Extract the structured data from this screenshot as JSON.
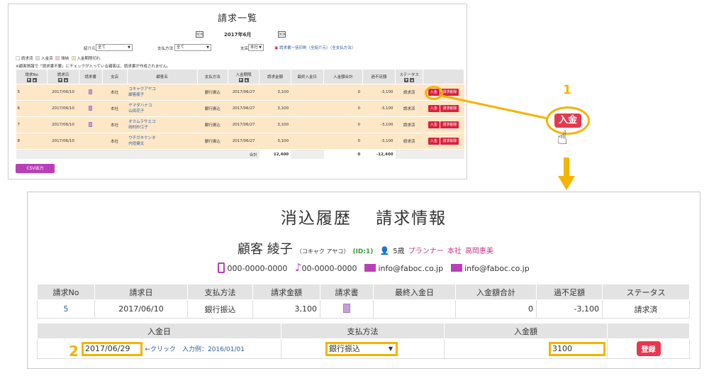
{
  "top": {
    "title": "請求一覧",
    "month": "2017年6月",
    "prev": "<<",
    "next": ">>",
    "filters": [
      {
        "label": "紹介元",
        "value": "全て"
      },
      {
        "label": "支払方法",
        "value": "全て"
      },
      {
        "label": "支店",
        "value": "本社"
      }
    ],
    "print_link": "請求書一括印刷（全紹介元）（全支払方法）",
    "legend": [
      "請求済",
      "入金済",
      "滞納",
      "入金期限切れ"
    ],
    "note": "※顧客情報で「請求書不要」にチェックが入っている顧客は、請求書が作成されません。",
    "columns": [
      "請求No",
      "請求日",
      "請求書",
      "支店",
      "顧客名",
      "支払方法",
      "入金期限",
      "請求金額",
      "最終入金日",
      "入金額合計",
      "過不足額",
      "ステータス",
      ""
    ],
    "rows": [
      {
        "no": "5",
        "date": "2017/06/10",
        "branch": "本社",
        "kana": "コキャクアヤコ",
        "name": "顧客綾子",
        "pay": "銀行振込",
        "due": "2017/06/27",
        "amount": "3,100",
        "total": "0",
        "diff": "-3,100",
        "status": "請求済",
        "has_doc": true
      },
      {
        "no": "6",
        "date": "2017/06/10",
        "branch": "本社",
        "kana": "ヤマダハナコ",
        "name": "山田花子",
        "pay": "銀行振込",
        "due": "2017/06/27",
        "amount": "3,100",
        "total": "0",
        "diff": "-3,100",
        "status": "請求済",
        "has_doc": true
      },
      {
        "no": "7",
        "date": "2017/06/10",
        "branch": "本社",
        "kana": "オカムラサエコ",
        "name": "岡村紗江子",
        "pay": "銀行振込",
        "due": "2017/06/27",
        "amount": "3,100",
        "total": "0",
        "diff": "-3,100",
        "status": "請求済",
        "has_doc": true
      },
      {
        "no": "8",
        "date": "2017/06/10",
        "branch": "本社",
        "kana": "ウチガキケンタ",
        "name": "内垣健太",
        "pay": "銀行振込",
        "due": "2017/06/27",
        "amount": "3,100",
        "total": "0",
        "diff": "-3,100",
        "status": "請求済",
        "has_doc": false
      }
    ],
    "total_label": "合計",
    "total_amount": "12,400",
    "total_paid": "0",
    "total_diff": "-12,400",
    "pay_btn": "入金",
    "delete_btn": "請求削除",
    "csv": "CSV出力"
  },
  "callout": {
    "step1": "1",
    "button": "入金",
    "step2": "2"
  },
  "bottom": {
    "title": "消込履歴　 請求情報",
    "customer": {
      "name": "顧客 綾子",
      "kana": "（コキャク アヤコ）",
      "id": "(ID:1)",
      "age": "5歳",
      "planner": "プランナー",
      "branch": "本社",
      "staff": "高岡恵美"
    },
    "contact": {
      "mobile": "000-0000-0000",
      "phone": "00-0000-0000",
      "email1": "info@faboc.co.jp",
      "email2": "info@faboc.co.jp"
    },
    "info_cols": [
      "請求No",
      "請求日",
      "支払方法",
      "請求金額",
      "請求書",
      "最終入金日",
      "入金額合計",
      "過不足額",
      "ステータス"
    ],
    "info_row": {
      "no": "5",
      "date": "2017/06/10",
      "pay": "銀行振込",
      "amount": "3,100",
      "last": "",
      "total": "0",
      "diff": "-3,100",
      "status": "請求済"
    },
    "form_cols": [
      "入金日",
      "支払方法",
      "入金額"
    ],
    "form": {
      "date": "2017/06/29",
      "hint": "←クリック　入力例：2016/01/01",
      "pay": "銀行振込",
      "amount": "3100",
      "submit": "登録"
    }
  }
}
